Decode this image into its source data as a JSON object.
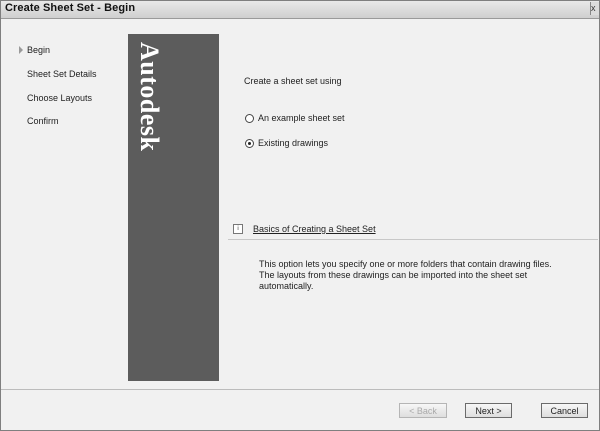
{
  "window": {
    "title": "Create Sheet Set - Begin",
    "close_label": "x"
  },
  "steps": [
    {
      "label": "Begin",
      "current": true
    },
    {
      "label": "Sheet Set Details",
      "current": false
    },
    {
      "label": "Choose Layouts",
      "current": false
    },
    {
      "label": "Confirm",
      "current": false
    }
  ],
  "brand": {
    "logo_text": "Autodesk"
  },
  "content": {
    "prompt": "Create a sheet set using",
    "options": [
      {
        "label": "An example sheet set",
        "selected": false
      },
      {
        "label": "Existing drawings",
        "selected": true
      }
    ],
    "help_icon_text": "i",
    "help_link": "Basics of Creating a Sheet Set",
    "description": "This option lets you specify one or more folders that contain drawing files.  The layouts from these drawings can be imported into the sheet set automatically."
  },
  "buttons": {
    "back": "< Back",
    "next": "Next >",
    "cancel": "Cancel"
  }
}
